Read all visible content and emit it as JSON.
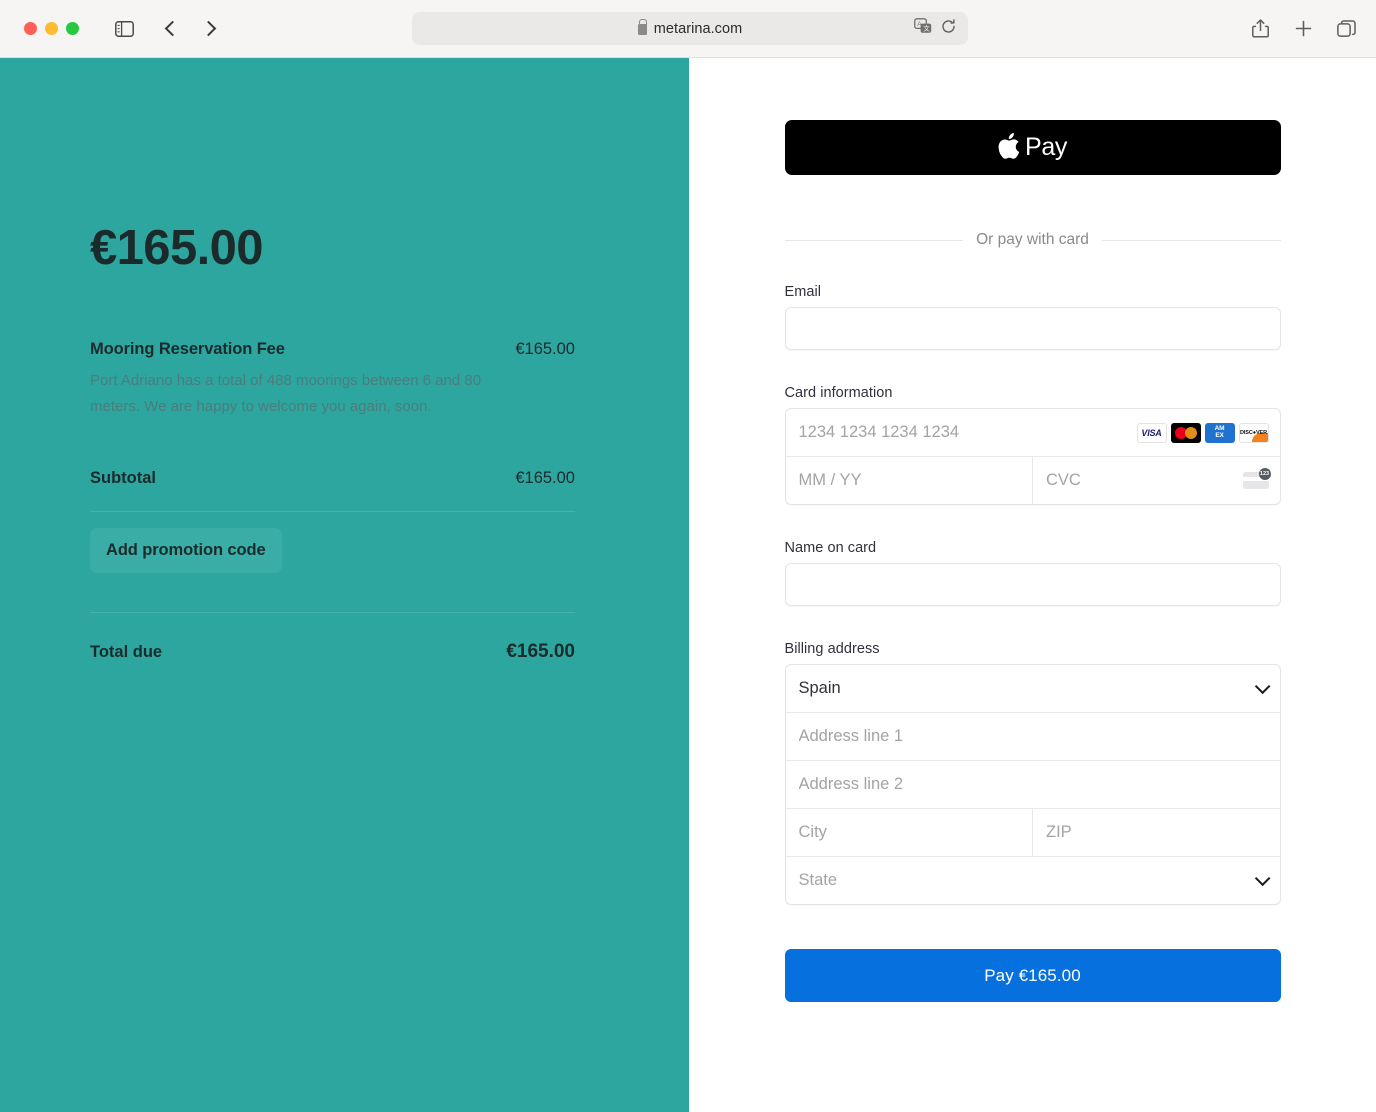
{
  "browser": {
    "url": "metarina.com",
    "lock_icon": "lock-icon",
    "sidebar_icon": "sidebar-toggle-icon",
    "back_icon": "chevron-left-icon",
    "forward_icon": "chevron-right-icon",
    "translate_icon": "translate-icon",
    "reload_icon": "reload-icon",
    "share_icon": "share-icon",
    "new_tab_icon": "plus-icon",
    "tabs_icon": "tab-overview-icon",
    "traffic_lights": [
      "close",
      "minimize",
      "zoom"
    ]
  },
  "summary": {
    "amount": "€165.00",
    "line_item": {
      "name": "Mooring Reservation Fee",
      "price": "€165.00",
      "description": "Port Adriano has a total of 488 moorings between 6 and 80 meters. We are happy to welcome you again, soon."
    },
    "subtotal_label": "Subtotal",
    "subtotal_value": "€165.00",
    "promo_label": "Add promotion code",
    "total_label": "Total due",
    "total_value": "€165.00"
  },
  "payment": {
    "apple_pay_label": "Pay",
    "apple_logo": "",
    "divider_text": "Or pay with card",
    "email_label": "Email",
    "email_value": "",
    "email_placeholder": "",
    "card_label": "Card information",
    "card_number_placeholder": "1234 1234 1234 1234",
    "card_number_value": "",
    "expiry_placeholder": "MM / YY",
    "expiry_value": "",
    "cvc_placeholder": "CVC",
    "cvc_value": "",
    "brands": [
      {
        "id": "visa-icon",
        "text": "VISA"
      },
      {
        "id": "mastercard-icon",
        "text": ""
      },
      {
        "id": "amex-icon",
        "line1": "AM",
        "line2": "EX"
      },
      {
        "id": "discover-icon",
        "text": "DISC●VER"
      }
    ],
    "cvc_hint_icon": "cvc-card-icon",
    "cvc_hint_badge": "123",
    "name_label": "Name on card",
    "name_value": "",
    "name_placeholder": "",
    "billing_label": "Billing address",
    "country_value": "Spain",
    "address1_placeholder": "Address line 1",
    "address1_value": "",
    "address2_placeholder": "Address line 2",
    "address2_value": "",
    "city_placeholder": "City",
    "city_value": "",
    "zip_placeholder": "ZIP",
    "zip_value": "",
    "state_placeholder": "State",
    "pay_button_label": "Pay €165.00"
  },
  "colors": {
    "brand_teal": "#2ea6a0",
    "promo_teal": "#3aada7",
    "pay_blue": "#0570de",
    "apple_pay_black": "#000000",
    "text_dark": "#1b2b2b",
    "muted_teal_text": "#4a7d7c"
  }
}
